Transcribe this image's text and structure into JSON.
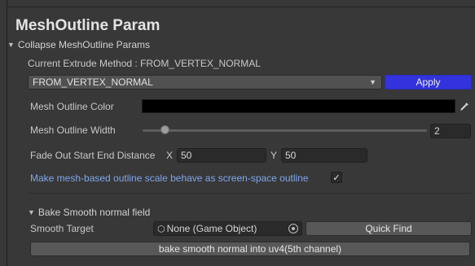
{
  "header": {
    "title": "MeshOutline Param"
  },
  "foldout_main": {
    "label": "Collapse MeshOutline Params"
  },
  "extrude": {
    "current_label": "Current Extrude Method : FROM_VERTEX_NORMAL",
    "dropdown_value": "FROM_VERTEX_NORMAL",
    "apply_label": "Apply",
    "accent_color": "#3333dd"
  },
  "outline_color": {
    "label": "Mesh Outline Color",
    "value": "#000000"
  },
  "outline_width": {
    "label": "Mesh Outline Width",
    "value": "2",
    "slider_fraction": 0.08
  },
  "fade": {
    "label": "Fade Out Start End Distance",
    "x_label": "X",
    "x_value": "50",
    "y_label": "Y",
    "y_value": "50"
  },
  "screen_space": {
    "label": "Make mesh-based outline scale behave as screen-space outline",
    "checked": true,
    "check_glyph": "✓"
  },
  "bake": {
    "foldout_label": "Bake Smooth normal field",
    "target_label": "Smooth Target",
    "target_value": "None (Game Object)",
    "quick_find_label": "Quick Find",
    "bake_button_label": "bake smooth normal into uv4(5th channel)"
  },
  "icons": {
    "foldout": "triangle-down-icon",
    "picker": "eyedropper-icon",
    "object": "cube-icon",
    "target": "object-picker-icon"
  }
}
